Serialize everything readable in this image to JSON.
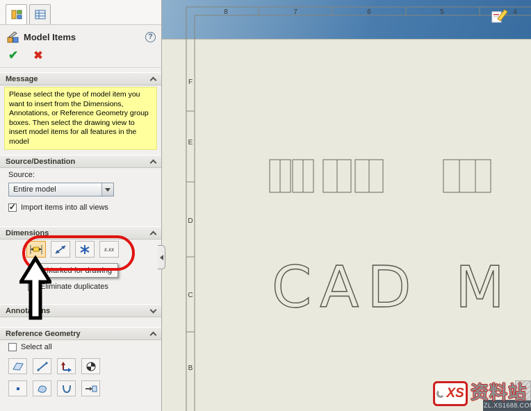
{
  "panel": {
    "title": "Model Items",
    "help_glyph": "?",
    "ok_glyph": "✔",
    "cancel_glyph": "✖",
    "sections": {
      "message": {
        "header": "Message",
        "text": "Please select the type of model item you want to insert from the Dimensions, Annotations, or Reference Geometry group boxes. Then select the drawing view  to insert model items for all features in the model"
      },
      "source_destination": {
        "header": "Source/Destination",
        "source_label": "Source:",
        "source_value": "Entire model",
        "import_label": "Import items into all views"
      },
      "dimensions": {
        "header": "Dimensions",
        "tolerance_icon_text": "x.xx",
        "eliminate_label": "Eliminate duplicates"
      },
      "annotations": {
        "header": "Annotations"
      },
      "reference_geometry": {
        "header": "Reference Geometry",
        "select_all_label": "Select all"
      }
    },
    "tooltip_text": "Marked for drawing"
  },
  "drawing": {
    "column_labels": [
      "8",
      "7",
      "6",
      "5",
      "4"
    ],
    "row_labels": [
      "F",
      "E",
      "D",
      "C",
      "B"
    ],
    "outline_text": {
      "left": "CAD",
      "right": "M"
    }
  },
  "watermark": {
    "logo_text": "XS",
    "site_name": "资料站",
    "site_url": "ZL.XS1688.COM"
  }
}
